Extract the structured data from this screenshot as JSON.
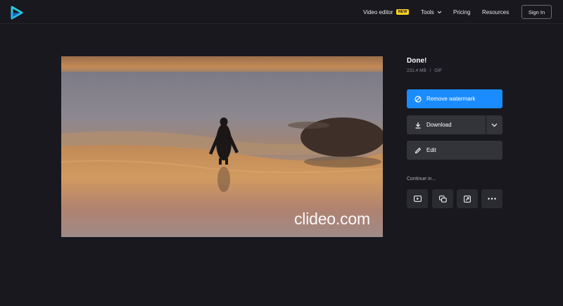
{
  "header": {
    "logo_icon": "clideo-play-logo-icon",
    "nav": {
      "video_editor": "Video editor",
      "video_editor_badge": "NEW",
      "tools": "Tools",
      "pricing": "Pricing",
      "resources": "Resources"
    },
    "sign_in": "Sign In"
  },
  "preview": {
    "watermark": "clideo.com"
  },
  "result": {
    "title": "Done!",
    "file_size": "231.4 MB",
    "separator": "/",
    "file_type": "GIF"
  },
  "actions": {
    "remove_watermark": "Remove watermark",
    "download": "Download",
    "edit": "Edit"
  },
  "continue": {
    "label": "Continue in...",
    "tools": [
      "youtube-play-icon",
      "copy-layers-icon",
      "crop-resize-icon",
      "more-dots-icon"
    ]
  },
  "colors": {
    "background": "#18181e",
    "accent": "#1a8cff",
    "badge": "#ffd21e",
    "button_dark": "#33333a"
  }
}
